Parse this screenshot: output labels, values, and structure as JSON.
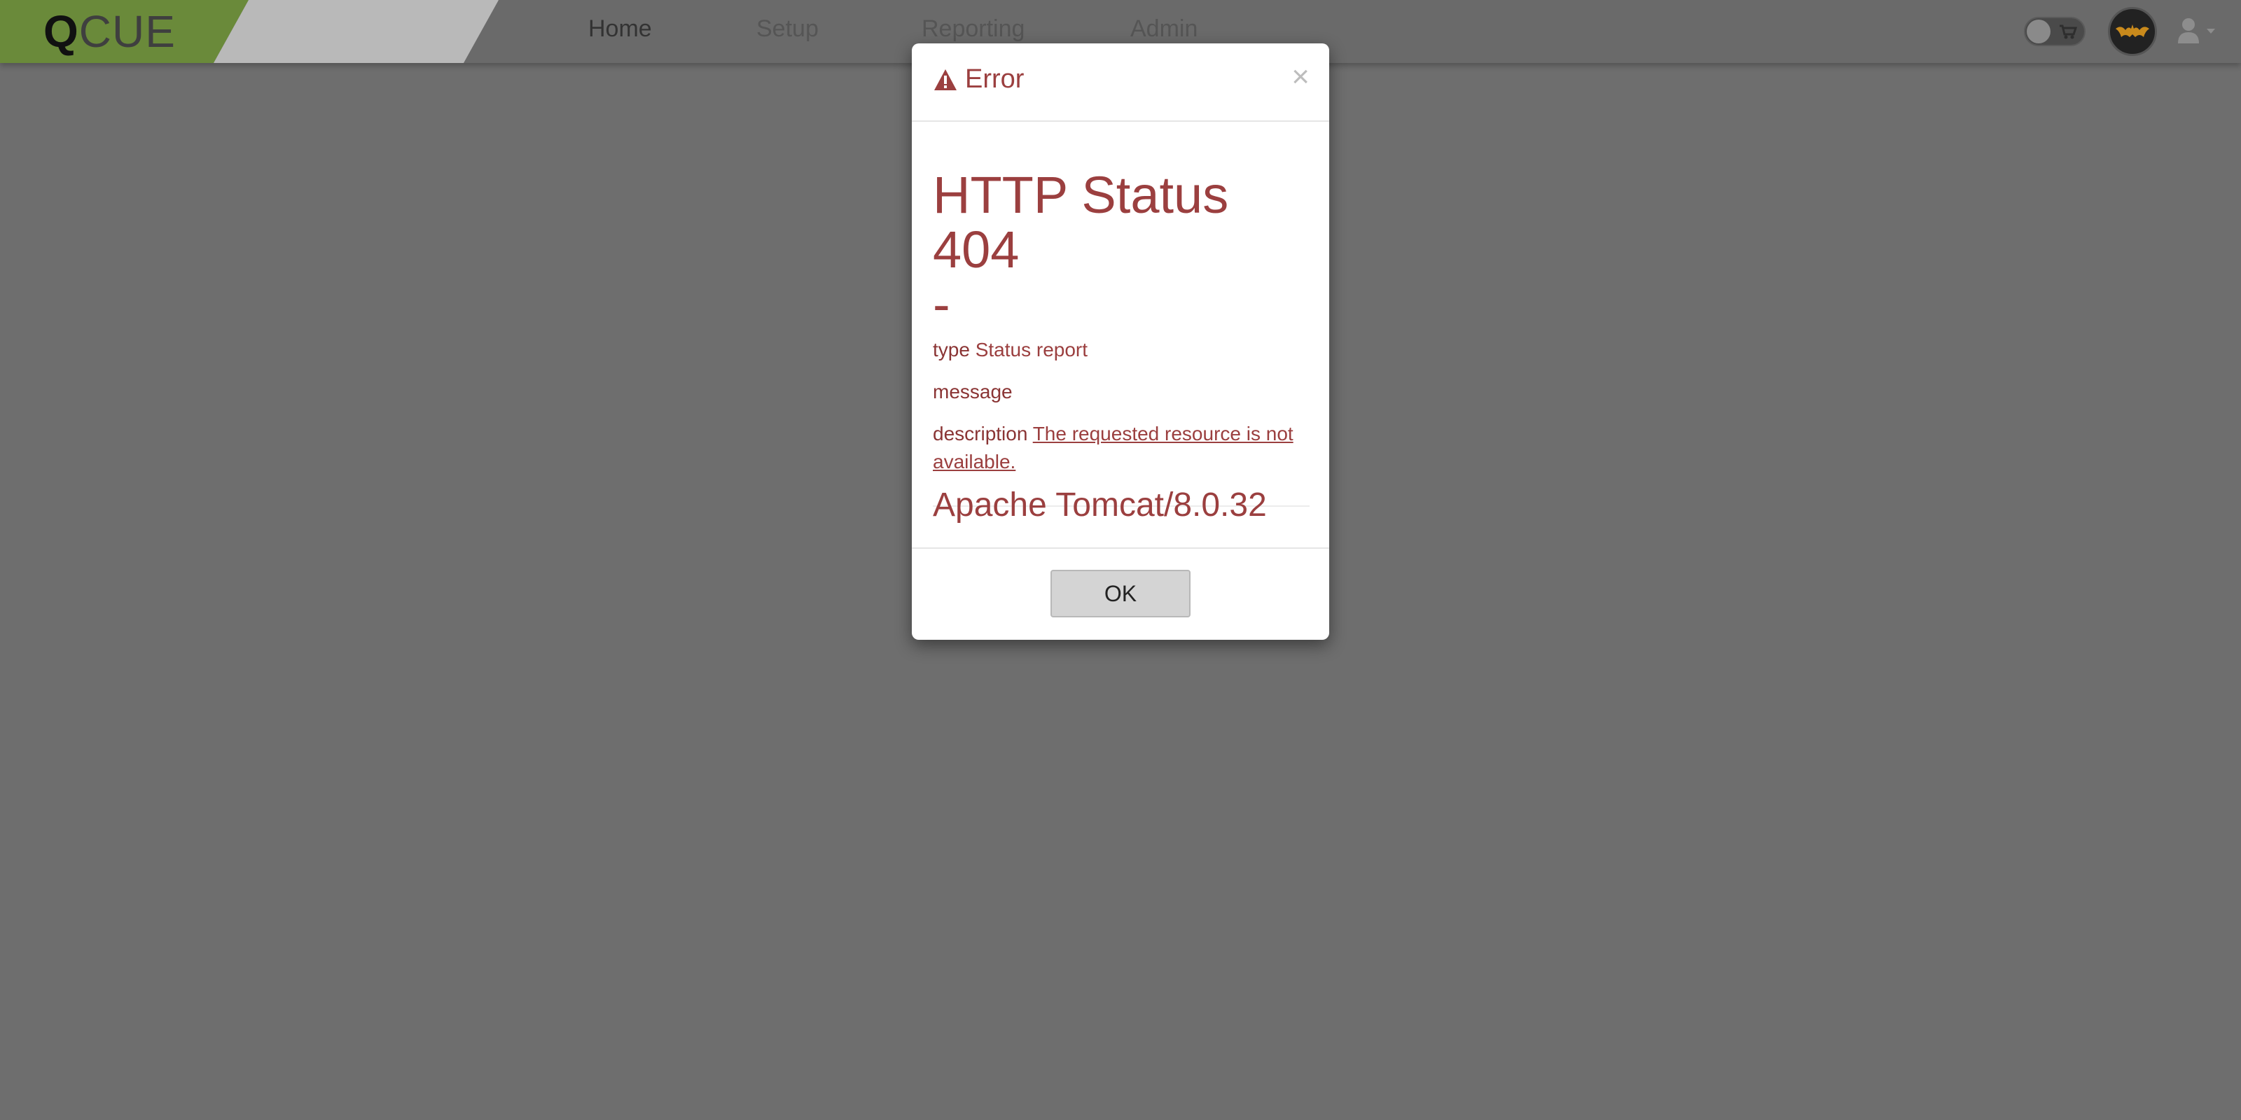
{
  "brand": {
    "logo_q": "Q",
    "logo_rest": "CUE",
    "accent_color": "#6a8a3a"
  },
  "nav": {
    "items": [
      {
        "label": "Home"
      },
      {
        "label": "Setup"
      },
      {
        "label": "Reporting"
      },
      {
        "label": "Admin"
      }
    ]
  },
  "header_right": {
    "toggle_icon": "cart-icon",
    "avatar_icon": "bat-icon",
    "user_icon": "user-icon",
    "caret_icon": "caret-down-icon"
  },
  "dialog": {
    "title": "Error",
    "title_icon": "warning-icon",
    "close_label": "×",
    "heading_line1": "HTTP Status 404",
    "heading_line2": "-",
    "type_label": "type",
    "type_value": "Status report",
    "message_label": "message",
    "description_label": "description",
    "description_value": "The requested resource is not available.",
    "server": "Apache Tomcat/8.0.32",
    "ok_label": "OK",
    "text_color": "#9b3f3f"
  }
}
